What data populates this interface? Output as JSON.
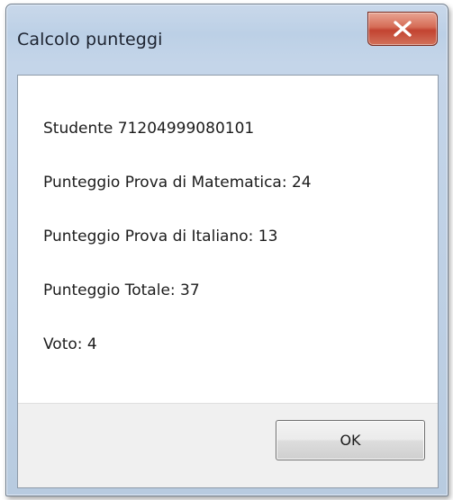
{
  "window": {
    "title": "Calcolo punteggi"
  },
  "message": {
    "lines": [
      "Studente 71204999080101",
      "Punteggio Prova di Matematica: 24",
      "Punteggio Prova di Italiano: 13",
      "Punteggio Totale: 37",
      "Voto: 4"
    ]
  },
  "buttons": {
    "ok_label": "OK"
  },
  "icons": {
    "close": "close-icon"
  },
  "colors": {
    "close_button": "#c24331",
    "title_bar": "#bcd0e6"
  }
}
